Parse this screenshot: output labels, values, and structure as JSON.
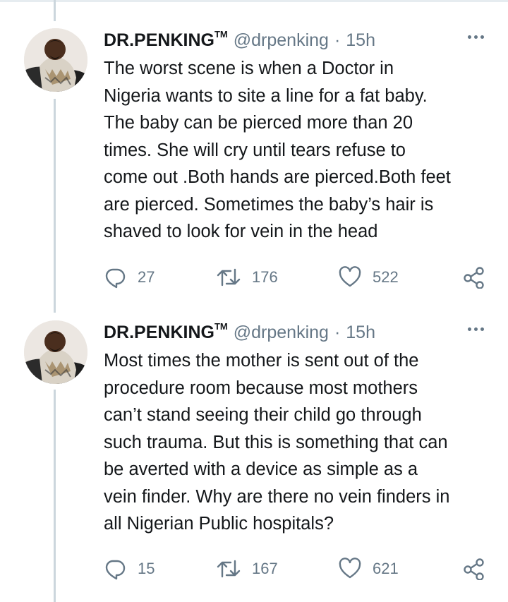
{
  "tweets": [
    {
      "author": {
        "name": "DR.PENKING",
        "trademark": "TM",
        "handle": "@drpenking",
        "separator": "·",
        "time": "15h"
      },
      "text": "The worst scene is when a Doctor in\nNigeria wants to site a line for a fat baby.\nThe baby can be pierced more than 20\ntimes. She will cry until tears refuse to\ncome out .Both hands are pierced.Both feet\nare pierced. Sometimes the baby’s hair is\nshaved to look for vein in the head",
      "stats": {
        "replies": "27",
        "retweets": "176",
        "likes": "522"
      },
      "icons": {
        "reply": "reply-icon",
        "retweet": "retweet-icon",
        "like": "heart-icon",
        "share": "share-icon",
        "more": "more-icon"
      }
    },
    {
      "author": {
        "name": "DR.PENKING",
        "trademark": "TM",
        "handle": "@drpenking",
        "separator": "·",
        "time": "15h"
      },
      "text": "Most times the mother is sent out of the\nprocedure room because most mothers\ncan’t stand seeing their child go through\nsuch trauma. But this is something that can\nbe averted with a device as simple as a\nvein finder. Why are there no vein finders in\nall Nigerian Public hospitals?",
      "stats": {
        "replies": "15",
        "retweets": "167",
        "likes": "621"
      },
      "icons": {
        "reply": "reply-icon",
        "retweet": "retweet-icon",
        "like": "heart-icon",
        "share": "share-icon",
        "more": "more-icon"
      }
    }
  ],
  "colors": {
    "text": "#14171a",
    "secondary": "#657786",
    "thread_line": "#ccd6dd",
    "divider": "#e6ecf0"
  }
}
